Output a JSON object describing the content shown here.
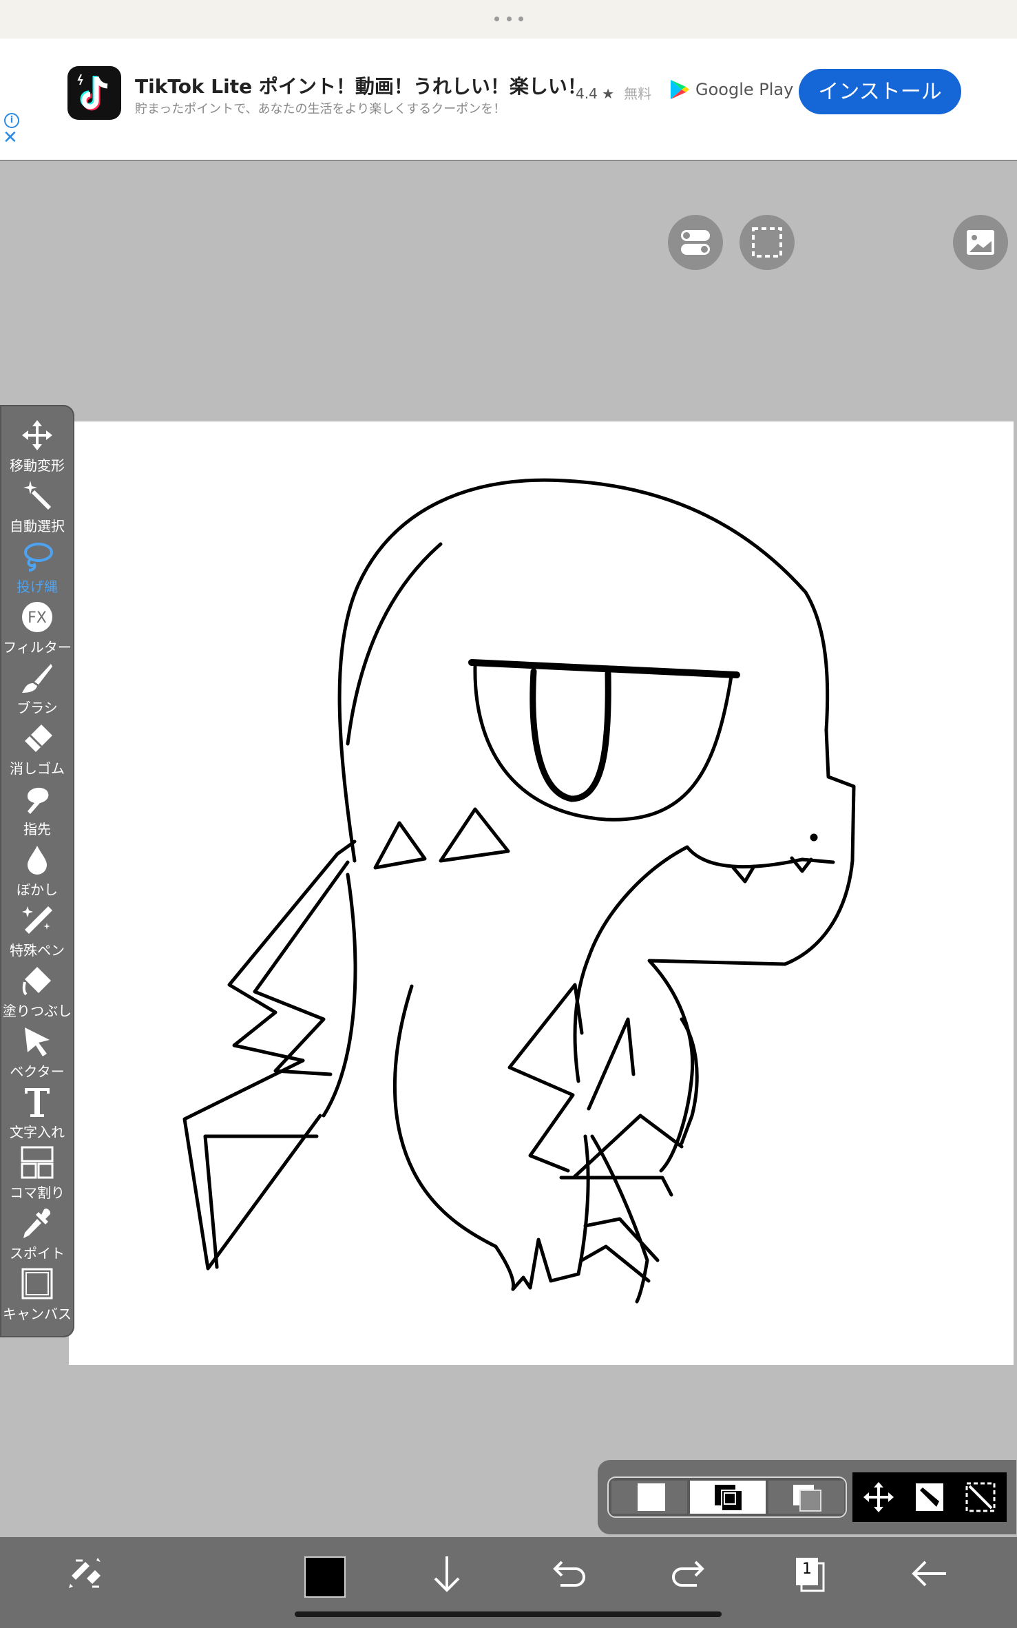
{
  "ad": {
    "title": "TikTok Lite ポイント！動画！うれしい！楽しい！",
    "subtitle": "貯まったポイントで、あなたの生活をより楽しくするクーポンを！",
    "rating": "4.4 ★",
    "price": "無料",
    "store": "Google Play",
    "install_label": "インストール",
    "info_symbol": "i",
    "close_symbol": "✕"
  },
  "toolbar": {
    "active": "投げ縄",
    "tools": [
      {
        "label": "移動変形",
        "icon": "move-arrows-icon"
      },
      {
        "label": "自動選択",
        "icon": "magic-wand-icon"
      },
      {
        "label": "投げ縄",
        "icon": "lasso-icon"
      },
      {
        "label": "フィルター",
        "icon": "fx-icon"
      },
      {
        "label": "ブラシ",
        "icon": "brush-icon"
      },
      {
        "label": "消しゴム",
        "icon": "eraser-icon"
      },
      {
        "label": "指先",
        "icon": "finger-smudge-icon"
      },
      {
        "label": "ぼかし",
        "icon": "blur-drop-icon"
      },
      {
        "label": "特殊ペン",
        "icon": "special-pen-icon"
      },
      {
        "label": "塗りつぶし",
        "icon": "fill-bucket-icon"
      },
      {
        "label": "ベクター",
        "icon": "vector-cursor-icon"
      },
      {
        "label": "文字入れ",
        "icon": "text-t-icon"
      },
      {
        "label": "コマ割り",
        "icon": "panel-layout-icon"
      },
      {
        "label": "スポイト",
        "icon": "eyedropper-icon"
      },
      {
        "label": "キャンバス",
        "icon": "canvas-icon"
      }
    ]
  },
  "layer_bar": {
    "fx_label": "FX",
    "layer_count": "1"
  },
  "colors": {
    "accent": "#4da3f2",
    "install_button": "#1566d6",
    "current_color": "#000000",
    "panel": "#6e6e6e"
  }
}
